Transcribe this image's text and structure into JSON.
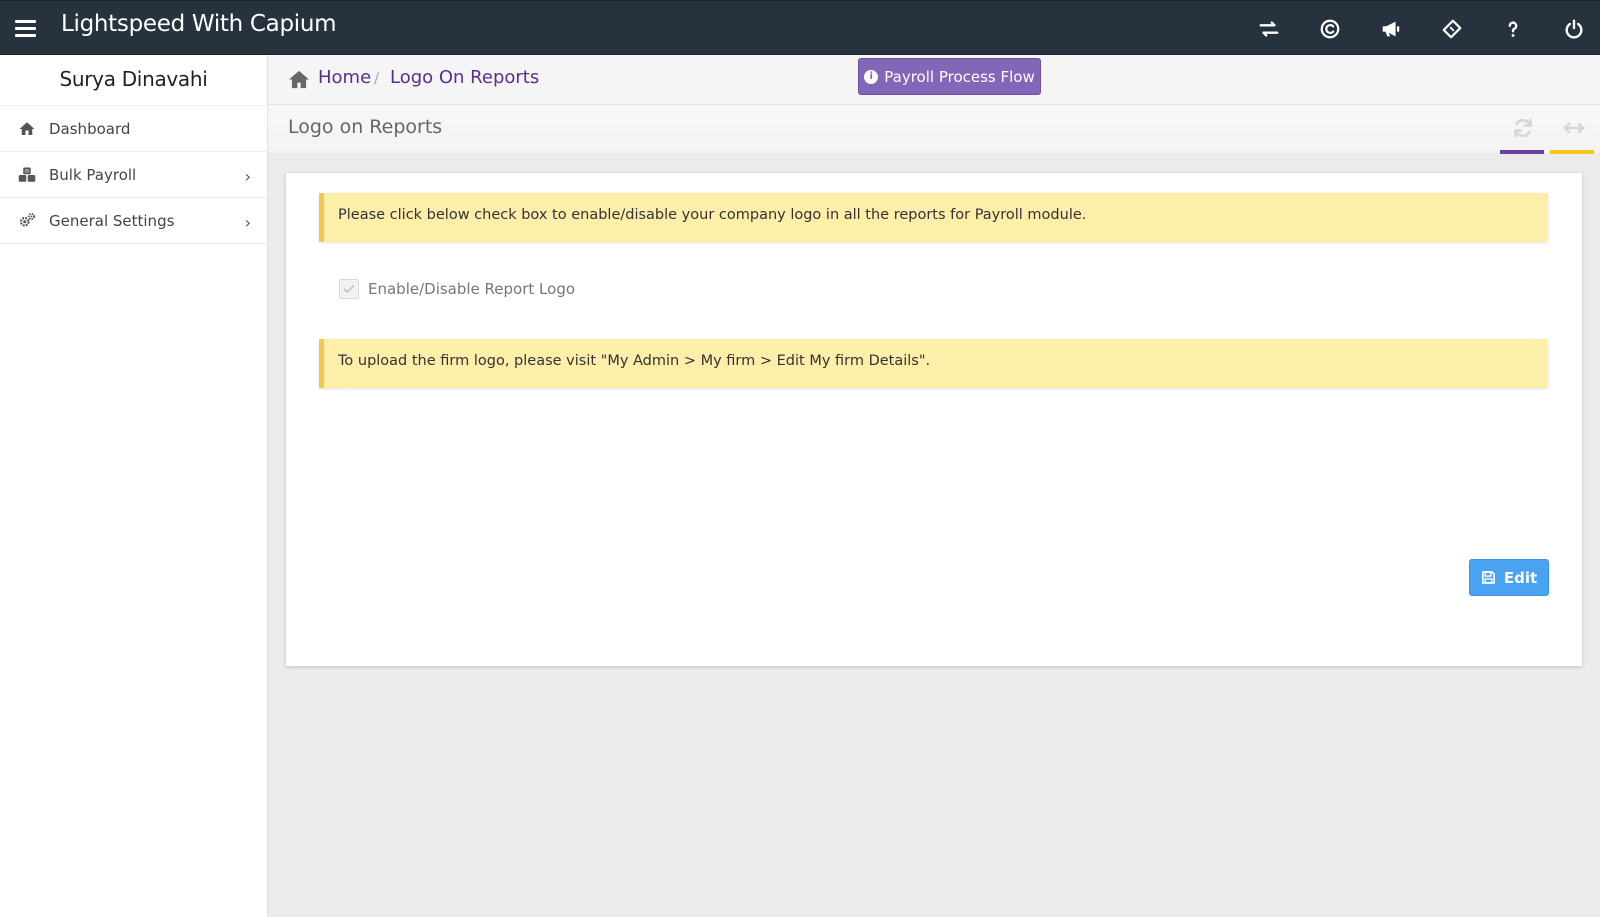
{
  "header": {
    "app_title": "Lightspeed With Capium",
    "icons": [
      "transfer-icon",
      "capium-logo-icon",
      "megaphone-icon",
      "ticket-icon",
      "help-icon",
      "power-icon"
    ],
    "background_color": "#27323f"
  },
  "sidebar": {
    "user_name": "Surya Dinavahi",
    "items": [
      {
        "label": "Dashboard",
        "icon": "home-icon",
        "has_submenu": false
      },
      {
        "label": "Bulk Payroll",
        "icon": "cubes-icon",
        "has_submenu": true
      },
      {
        "label": "General Settings",
        "icon": "gears-icon",
        "has_submenu": true
      }
    ]
  },
  "breadcrumb": {
    "home": "Home",
    "separator": "/",
    "current": "Logo On Reports",
    "link_color": "#5b2d8e"
  },
  "flow_button": {
    "label": "Payroll Process Flow",
    "color": "#8266b8"
  },
  "page": {
    "title": "Logo on Reports",
    "accent_purple": "#6b3fa0",
    "accent_yellow": "#f5c518"
  },
  "content": {
    "alert1": "Please click below check box to enable/disable your company logo in all the reports for Payroll module.",
    "checkbox_label": "Enable/Disable Report Logo",
    "checkbox_checked": true,
    "checkbox_disabled": true,
    "alert2": "To upload the firm logo, please visit \"My Admin > My firm > Edit My firm Details\".",
    "alert_color": "#fdeeaa",
    "edit_label": "Edit",
    "edit_color": "#4aa3f0"
  }
}
